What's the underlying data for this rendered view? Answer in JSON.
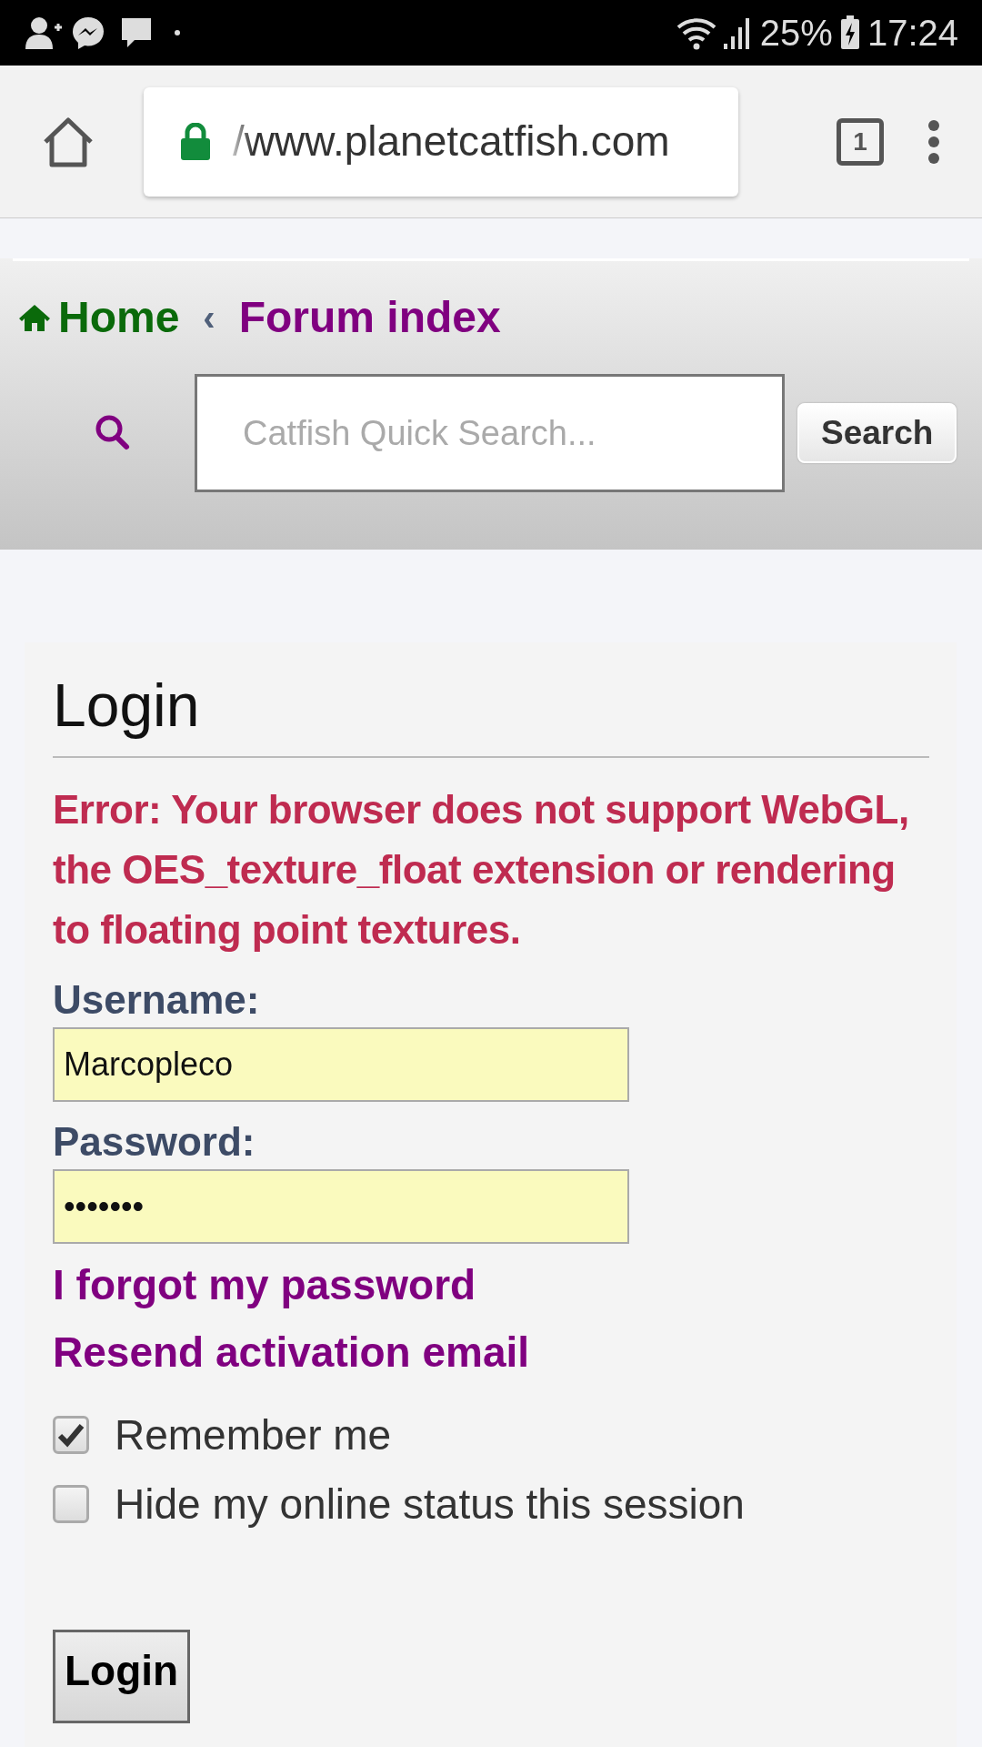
{
  "status_bar": {
    "battery": "25%",
    "time": "17:24"
  },
  "browser": {
    "url": "/www.planetcatfish.com",
    "tab_count": "1"
  },
  "breadcrumbs": [
    {
      "label": "Home",
      "kind": "home"
    },
    {
      "label": "Forum index",
      "kind": "link"
    }
  ],
  "breadcrumb_separator": "‹",
  "search": {
    "placeholder": "Catfish Quick Search...",
    "button": "Search"
  },
  "login": {
    "title": "Login",
    "error": "Error: Your browser does not support WebGL, the OES_texture_float extension or rendering to floating point textures.",
    "fields": [
      {
        "label": "Username:",
        "value": "Marcopleco"
      },
      {
        "label": "Password:",
        "value": "•••••••"
      }
    ],
    "links": [
      "I forgot my password",
      "Resend activation email"
    ],
    "options": [
      {
        "label": "Remember me",
        "checked": true
      },
      {
        "label": "Hide my online status this session",
        "checked": false
      }
    ],
    "submit": "Login"
  }
}
